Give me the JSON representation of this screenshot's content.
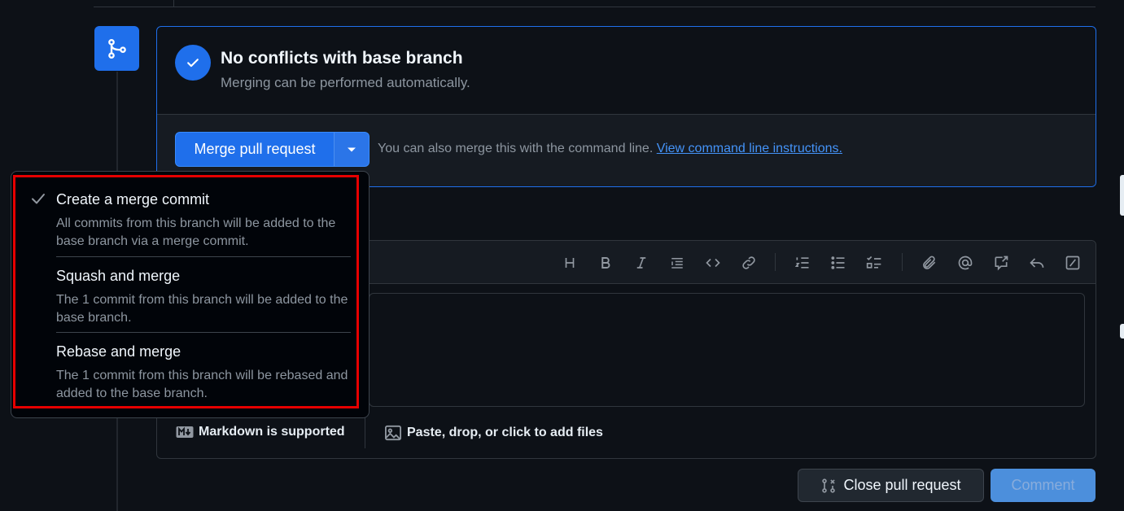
{
  "merge_status": {
    "title": "No conflicts with base branch",
    "subtitle": "Merging can be performed automatically."
  },
  "merge_actions": {
    "merge_button_label": "Merge pull request",
    "command_line_text": "You can also merge this with the command line.",
    "command_line_link": "View command line instructions."
  },
  "merge_options": [
    {
      "label": "Create a merge commit",
      "description": "All commits from this branch will be added to the base branch via a merge commit.",
      "selected": true
    },
    {
      "label": "Squash and merge",
      "description": "The 1 commit from this branch will be added to the base branch.",
      "selected": false
    },
    {
      "label": "Rebase and merge",
      "description": "The 1 commit from this branch will be rebased and added to the base branch.",
      "selected": false
    }
  ],
  "editor_toolbar": {
    "icons": [
      "heading-icon",
      "bold-icon",
      "italic-icon",
      "quote-icon",
      "code-icon",
      "link-icon",
      "ordered-list-icon",
      "unordered-list-icon",
      "task-list-icon",
      "attach-icon",
      "mention-icon",
      "reference-icon",
      "reply-icon",
      "slash-commands-icon"
    ]
  },
  "editor_footer": {
    "markdown_label": "Markdown is supported",
    "attach_label": "Paste, drop, or click to add files"
  },
  "buttons": {
    "close_pr_label": "Close pull request",
    "comment_label": "Comment"
  },
  "colors": {
    "accent": "#1f6feb",
    "highlight_border": "#e60000",
    "background": "#0d1117"
  }
}
